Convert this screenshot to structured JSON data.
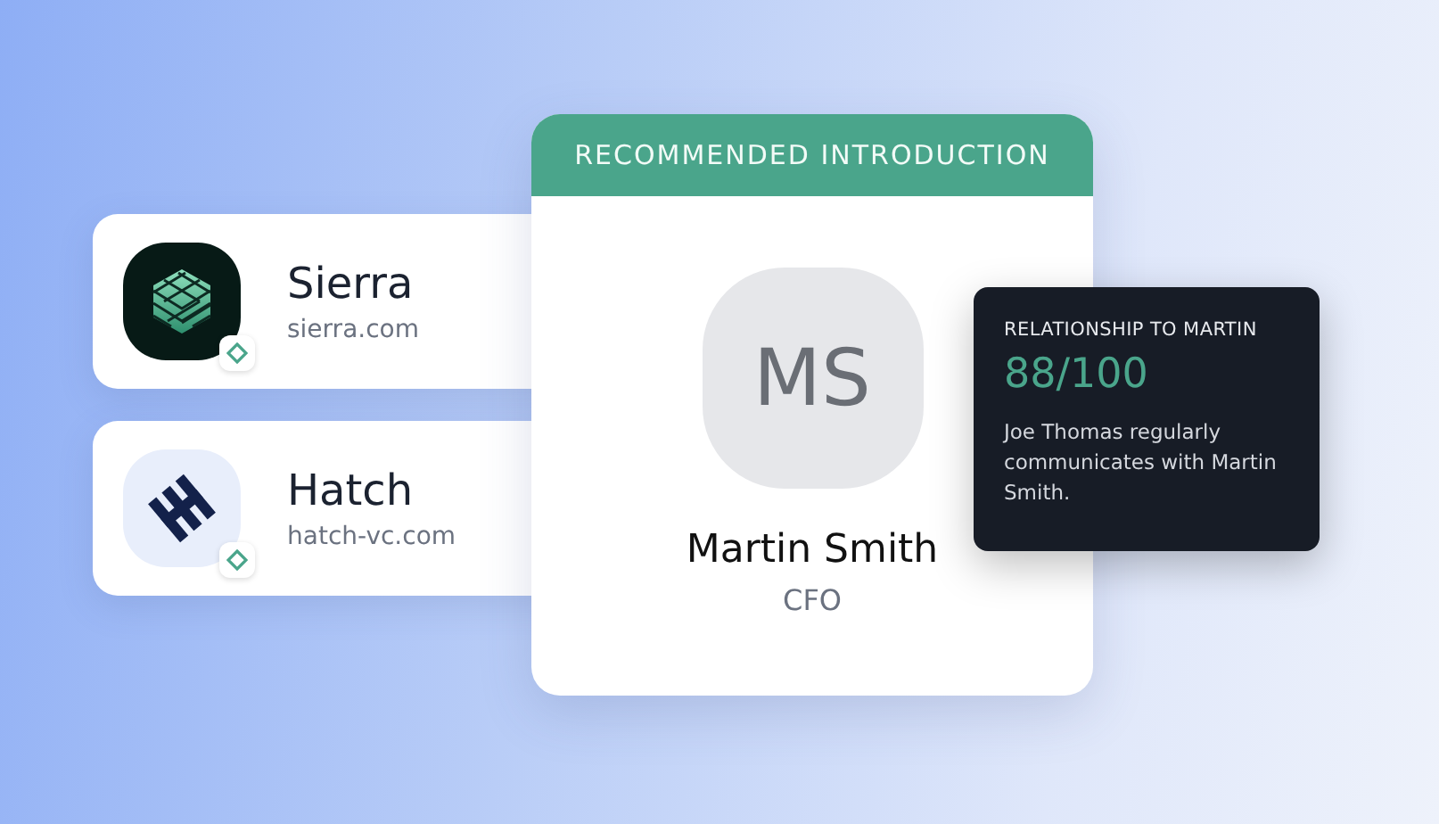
{
  "companies": [
    {
      "name": "Sierra",
      "domain": "sierra.com",
      "kind": "sierra"
    },
    {
      "name": "Hatch",
      "domain": "hatch-vc.com",
      "kind": "hatch"
    }
  ],
  "introduction": {
    "header": "RECOMMENDED INTRODUCTION",
    "initials": "MS",
    "name": "Martin Smith",
    "role": "CFO"
  },
  "relationship": {
    "title": "RELATIONSHIP TO MARTIN",
    "score": "88/100",
    "description": "Joe Thomas regularly communicates with Martin Smith."
  }
}
